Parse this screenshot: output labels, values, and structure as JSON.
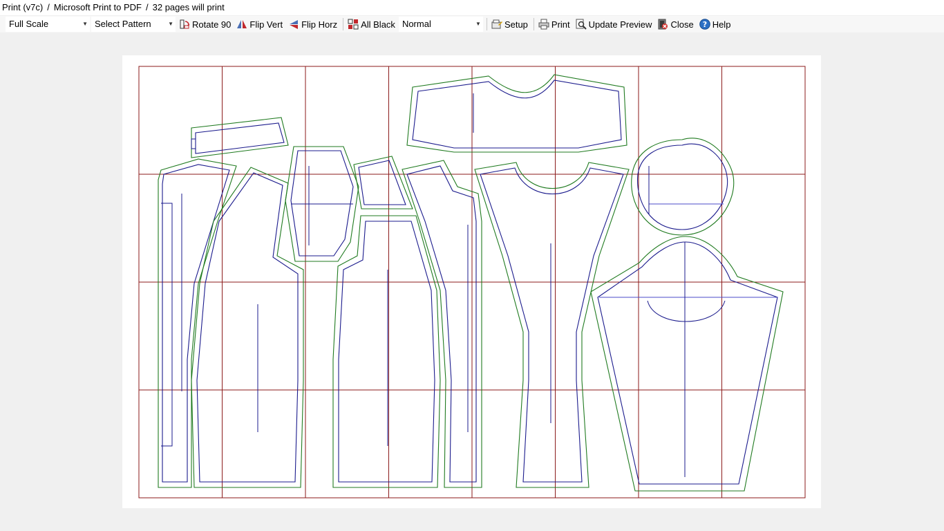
{
  "titlebar": {
    "app": "Print (v7c)",
    "sep1": "/",
    "printer": "Microsoft Print to PDF",
    "sep2": "/",
    "pages": "32 pages will print"
  },
  "toolbar": {
    "scale": "Full Scale",
    "pattern": "Select Pattern",
    "rotate": "Rotate 90",
    "flip_vert": "Flip Vert",
    "flip_horz": "Flip Horz",
    "all_black": "All Black",
    "mode": "Normal",
    "setup": "Setup",
    "print": "Print",
    "update_preview": "Update Preview",
    "close": "Close",
    "help": "Help"
  },
  "preview": {
    "grid_color": "#8b1a1a",
    "seam_color": "#1f7a1f",
    "cut_color": "#1a1a8c",
    "page_columns": 8,
    "page_rows": 4
  },
  "colors": {
    "accent": "#1f5fb4"
  }
}
